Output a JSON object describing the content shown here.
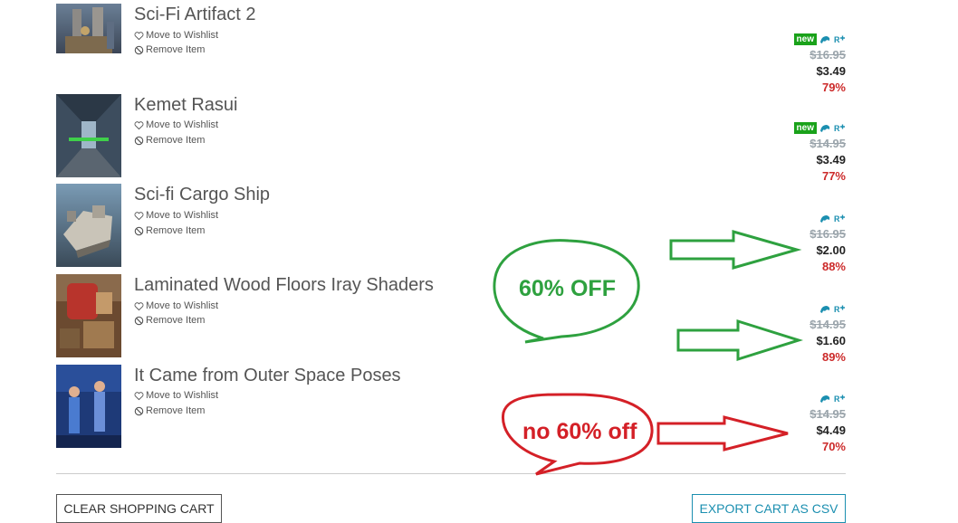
{
  "actions": {
    "wishlist": "Move to Wishlist",
    "remove": "Remove Item"
  },
  "items": [
    {
      "title": "Sci-Fi Artifact 2",
      "new_badge": "new",
      "original": "$16.95",
      "price": "$3.49",
      "discount": "79%"
    },
    {
      "title": "Kemet Rasui",
      "new_badge": "new",
      "original": "$14.95",
      "price": "$3.49",
      "discount": "77%"
    },
    {
      "title": "Sci-fi Cargo Ship",
      "new_badge": "",
      "original": "$16.95",
      "price": "$2.00",
      "discount": "88%"
    },
    {
      "title": "Laminated Wood Floors Iray Shaders",
      "new_badge": "",
      "original": "$14.95",
      "price": "$1.60",
      "discount": "89%"
    },
    {
      "title": "It Came from Outer Space Poses",
      "new_badge": "",
      "original": "$14.95",
      "price": "$4.49",
      "discount": "70%"
    }
  ],
  "buttons": {
    "clear": "CLEAR SHOPPING CART",
    "export": "EXPORT CART AS CSV"
  },
  "annotations": {
    "green_bubble": "60% OFF",
    "red_bubble": "no 60% off"
  },
  "colors": {
    "annotation_green": "#2ea13f",
    "annotation_red": "#d42027",
    "accent_blue": "#1b8fb0",
    "discount_red": "#cc2a2a"
  },
  "icons": {
    "wishlist": "heart-icon",
    "remove": "ban-icon",
    "badge_a": "genesis-icon",
    "badge_b": "daz-icon"
  }
}
